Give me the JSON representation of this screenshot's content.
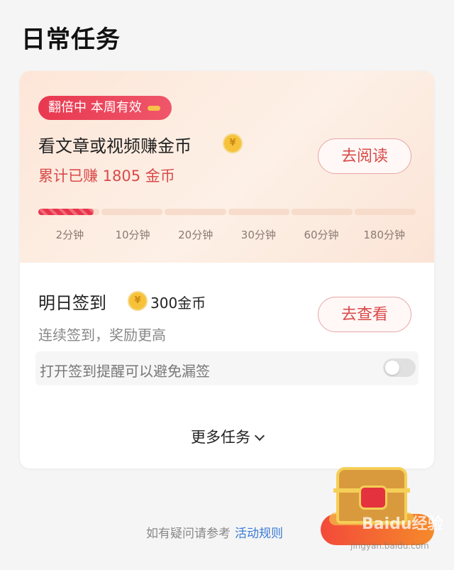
{
  "page": {
    "title": "日常任务"
  },
  "read_task": {
    "badge": "翻倍中 本周有效",
    "title": "看文章或视频赚金币",
    "earned": "累计已赚 1805 金币",
    "button": "去阅读",
    "progress_fraction_of_first_segment": 0.9,
    "ticks": [
      "2分钟",
      "10分钟",
      "20分钟",
      "30分钟",
      "60分钟",
      "180分钟"
    ]
  },
  "signin_task": {
    "title": "明日签到",
    "reward": "300金币",
    "subtitle": "连续签到，奖励更高",
    "button": "去查看",
    "reminder_text": "打开签到提醒可以避免漏签",
    "reminder_on": false
  },
  "more_tasks": {
    "label": "更多任务"
  },
  "footer": {
    "help_text": "如有疑问请参考",
    "help_link": "活动规则"
  },
  "coin_icon_symbol": "¥",
  "watermark": {
    "main": "Baidu经验",
    "sub": "jingyan.baidu.com"
  },
  "colors": {
    "accent_red": "#e8384f",
    "coin_gold": "#f7c23a"
  }
}
